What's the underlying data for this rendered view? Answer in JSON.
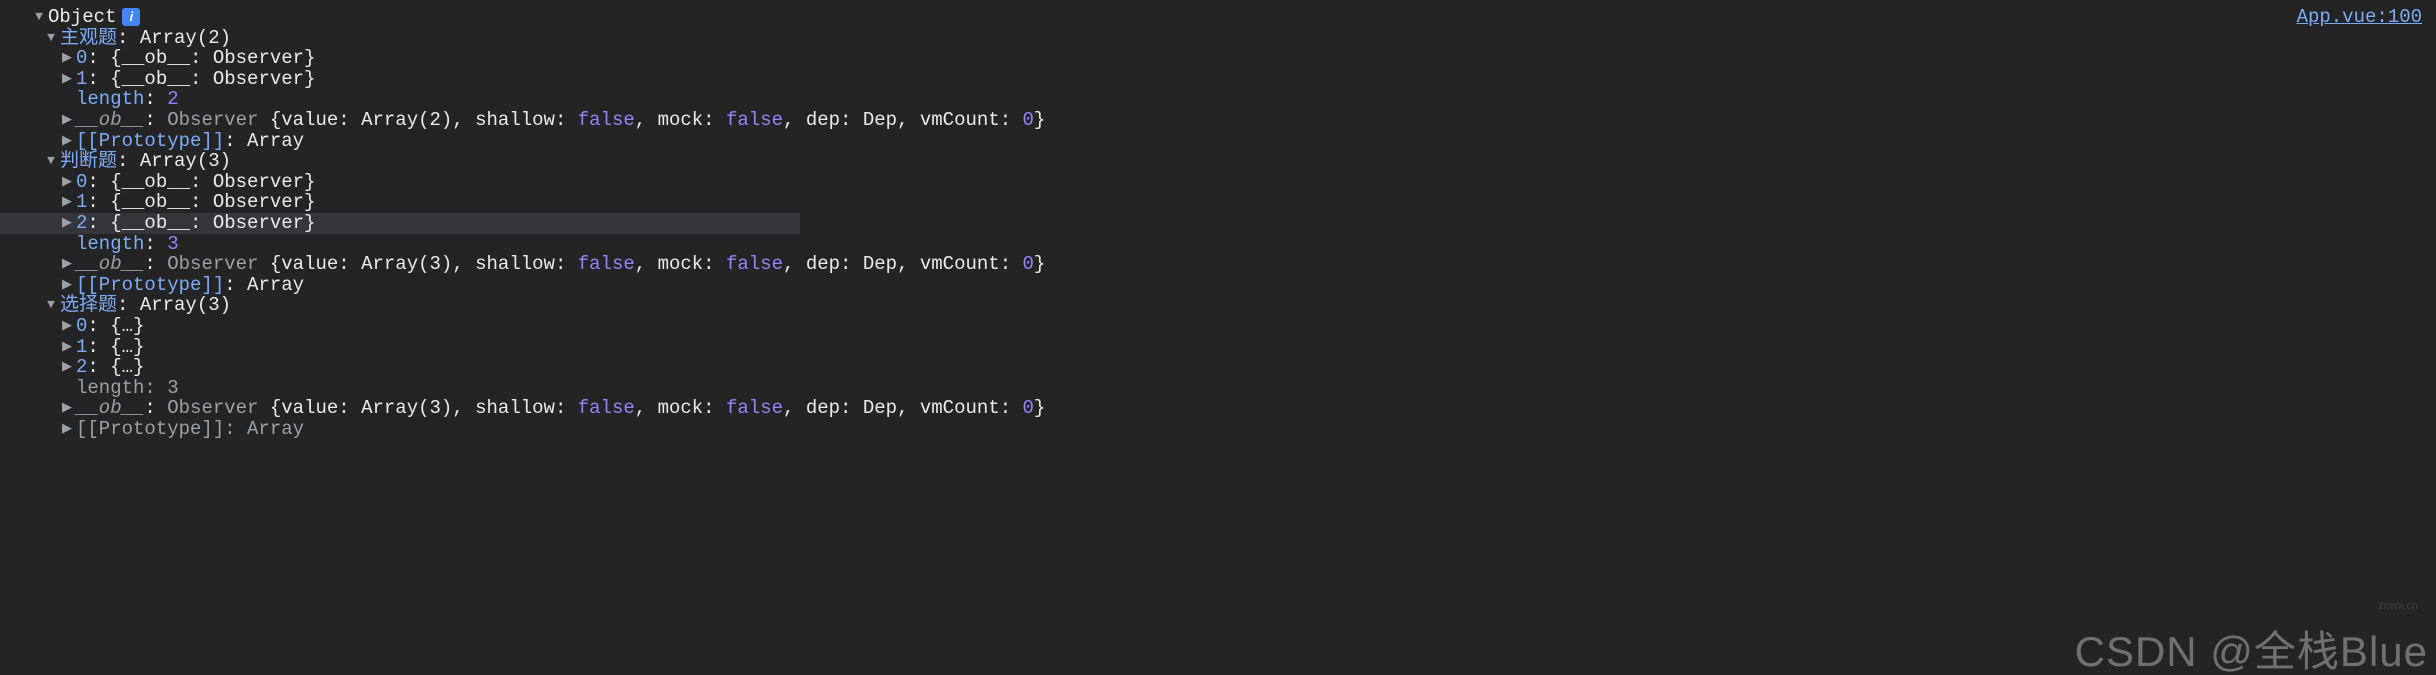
{
  "source_link": "App.vue:100",
  "root_label": "Object",
  "info_badge": "i",
  "watermark": "CSDN @全栈Blue",
  "watermark_small": "znwx.cn",
  "sections": [
    {
      "key": "主观题",
      "type_label": "Array(2)",
      "items": [
        {
          "idx": "0",
          "summary": "{__ob__: Observer}"
        },
        {
          "idx": "1",
          "summary": "{__ob__: Observer}"
        }
      ],
      "length_label": "length",
      "length_value": "2",
      "ob": {
        "key": "__ob__",
        "class": "Observer",
        "props": [
          {
            "k": "value",
            "v": "Array(2)",
            "type": "obj"
          },
          {
            "k": "shallow",
            "v": "false",
            "type": "bool"
          },
          {
            "k": "mock",
            "v": "false",
            "type": "bool"
          },
          {
            "k": "dep",
            "v": "Dep",
            "type": "obj"
          },
          {
            "k": "vmCount",
            "v": "0",
            "type": "num"
          }
        ]
      },
      "proto": {
        "label": "[[Prototype]]",
        "value": "Array"
      }
    },
    {
      "key": "判断题",
      "type_label": "Array(3)",
      "items": [
        {
          "idx": "0",
          "summary": "{__ob__: Observer}"
        },
        {
          "idx": "1",
          "summary": "{__ob__: Observer}"
        },
        {
          "idx": "2",
          "summary": "{__ob__: Observer}",
          "highlighted": true
        }
      ],
      "length_label": "length",
      "length_value": "3",
      "ob": {
        "key": "__ob__",
        "class": "Observer",
        "props": [
          {
            "k": "value",
            "v": "Array(3)",
            "type": "obj"
          },
          {
            "k": "shallow",
            "v": "false",
            "type": "bool"
          },
          {
            "k": "mock",
            "v": "false",
            "type": "bool"
          },
          {
            "k": "dep",
            "v": "Dep",
            "type": "obj"
          },
          {
            "k": "vmCount",
            "v": "0",
            "type": "num"
          }
        ]
      },
      "proto": {
        "label": "[[Prototype]]",
        "value": "Array"
      }
    },
    {
      "key": "选择题",
      "type_label": "Array(3)",
      "items": [
        {
          "idx": "0",
          "summary": "{…}"
        },
        {
          "idx": "1",
          "summary": "{…}"
        },
        {
          "idx": "2",
          "summary": "{…}"
        }
      ],
      "length_label": "length",
      "length_value": "3",
      "length_dim": true,
      "ob": {
        "key": "__ob__",
        "class": "Observer",
        "props": [
          {
            "k": "value",
            "v": "Array(3)",
            "type": "obj"
          },
          {
            "k": "shallow",
            "v": "false",
            "type": "bool"
          },
          {
            "k": "mock",
            "v": "false",
            "type": "bool"
          },
          {
            "k": "dep",
            "v": "Dep",
            "type": "obj"
          },
          {
            "k": "vmCount",
            "v": "0",
            "type": "num"
          }
        ]
      },
      "proto": {
        "label": "[[Prototype]]",
        "value": "Array",
        "dim": true
      }
    }
  ]
}
